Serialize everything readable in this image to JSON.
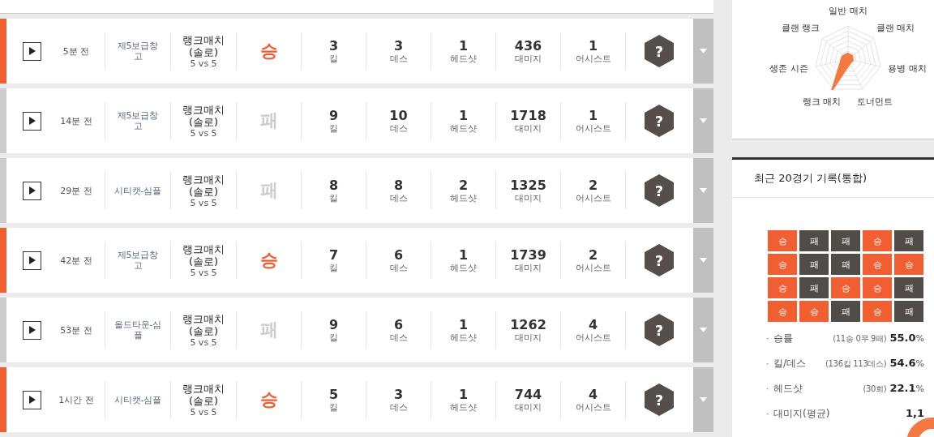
{
  "matches": [
    {
      "kind": "win",
      "result_text": "승",
      "time": "5분 전",
      "map": "제5보급창고",
      "mode": "랭크매치",
      "mode_sub": "(솔로)",
      "team": "5 vs 5",
      "stats": [
        {
          "value": "3",
          "label": "킬"
        },
        {
          "value": "3",
          "label": "데스"
        },
        {
          "value": "1",
          "label": "헤드샷"
        },
        {
          "value": "436",
          "label": "대미지"
        },
        {
          "value": "1",
          "label": "어시스트"
        }
      ],
      "badge": "?"
    },
    {
      "kind": "loss",
      "result_text": "패",
      "time": "14분 전",
      "map": "제5보급창고",
      "mode": "랭크매치",
      "mode_sub": "(솔로)",
      "team": "5 vs 5",
      "stats": [
        {
          "value": "9",
          "label": "킬"
        },
        {
          "value": "10",
          "label": "데스"
        },
        {
          "value": "1",
          "label": "헤드샷"
        },
        {
          "value": "1718",
          "label": "대미지"
        },
        {
          "value": "1",
          "label": "어시스트"
        }
      ],
      "badge": "?"
    },
    {
      "kind": "loss",
      "result_text": "패",
      "time": "29분 전",
      "map": "시티캣-심플",
      "mode": "랭크매치",
      "mode_sub": "(솔로)",
      "team": "5 vs 5",
      "stats": [
        {
          "value": "8",
          "label": "킬"
        },
        {
          "value": "8",
          "label": "데스"
        },
        {
          "value": "2",
          "label": "헤드샷"
        },
        {
          "value": "1325",
          "label": "대미지"
        },
        {
          "value": "2",
          "label": "어시스트"
        }
      ],
      "badge": "?"
    },
    {
      "kind": "win",
      "result_text": "승",
      "time": "42분 전",
      "map": "제5보급창고",
      "mode": "랭크매치",
      "mode_sub": "(솔로)",
      "team": "5 vs 5",
      "stats": [
        {
          "value": "7",
          "label": "킬"
        },
        {
          "value": "6",
          "label": "데스"
        },
        {
          "value": "1",
          "label": "헤드샷"
        },
        {
          "value": "1739",
          "label": "대미지"
        },
        {
          "value": "2",
          "label": "어시스트"
        }
      ],
      "badge": "?"
    },
    {
      "kind": "loss",
      "result_text": "패",
      "time": "53분 전",
      "map": "올드타운-심플",
      "mode": "랭크매치",
      "mode_sub": "(솔로)",
      "team": "5 vs 5",
      "stats": [
        {
          "value": "9",
          "label": "킬"
        },
        {
          "value": "6",
          "label": "데스"
        },
        {
          "value": "1",
          "label": "헤드샷"
        },
        {
          "value": "1262",
          "label": "대미지"
        },
        {
          "value": "4",
          "label": "어시스트"
        }
      ],
      "badge": "?"
    },
    {
      "kind": "win",
      "result_text": "승",
      "time": "1시간 전",
      "map": "시티캣-심플",
      "mode": "랭크매치",
      "mode_sub": "(솔로)",
      "team": "5 vs 5",
      "stats": [
        {
          "value": "5",
          "label": "킬"
        },
        {
          "value": "3",
          "label": "데스"
        },
        {
          "value": "1",
          "label": "헤드샷"
        },
        {
          "value": "744",
          "label": "대미지"
        },
        {
          "value": "4",
          "label": "어시스트"
        }
      ],
      "badge": "?"
    }
  ],
  "radar": {
    "labels": [
      "일반 매치",
      "클랜 매치",
      "용병 매치",
      "토너먼트",
      "랭크 매치",
      "생존 시즌",
      "클랜 랭크"
    ]
  },
  "recent": {
    "title": "최근 20경기 기록(통합)",
    "grid": [
      {
        "kind": "win",
        "text": "승"
      },
      {
        "kind": "loss",
        "text": "패"
      },
      {
        "kind": "loss",
        "text": "패"
      },
      {
        "kind": "win",
        "text": "승"
      },
      {
        "kind": "loss",
        "text": "패"
      },
      {
        "kind": "win",
        "text": "승"
      },
      {
        "kind": "loss",
        "text": "패"
      },
      {
        "kind": "loss",
        "text": "패"
      },
      {
        "kind": "win",
        "text": "승"
      },
      {
        "kind": "win",
        "text": "승"
      },
      {
        "kind": "win",
        "text": "승"
      },
      {
        "kind": "loss",
        "text": "패"
      },
      {
        "kind": "win",
        "text": "승"
      },
      {
        "kind": "win",
        "text": "승"
      },
      {
        "kind": "loss",
        "text": "패"
      },
      {
        "kind": "win",
        "text": "승"
      },
      {
        "kind": "win",
        "text": "승"
      },
      {
        "kind": "loss",
        "text": "패"
      },
      {
        "kind": "win",
        "text": "승"
      },
      {
        "kind": "loss",
        "text": "패"
      }
    ],
    "stats": [
      {
        "bullet": "·",
        "label": "승률",
        "detail": "(11승 0무 9패)",
        "value": "55.0",
        "unit": "%"
      },
      {
        "bullet": "·",
        "label": "킬/데스",
        "detail": "(136킬 113데스)",
        "value": "54.6",
        "unit": "%"
      },
      {
        "bullet": "·",
        "label": "헤드샷",
        "detail": "(30회)",
        "value": "22.1",
        "unit": "%"
      },
      {
        "bullet": "·",
        "label": "대미지(평균)",
        "value": "1,1"
      }
    ]
  }
}
